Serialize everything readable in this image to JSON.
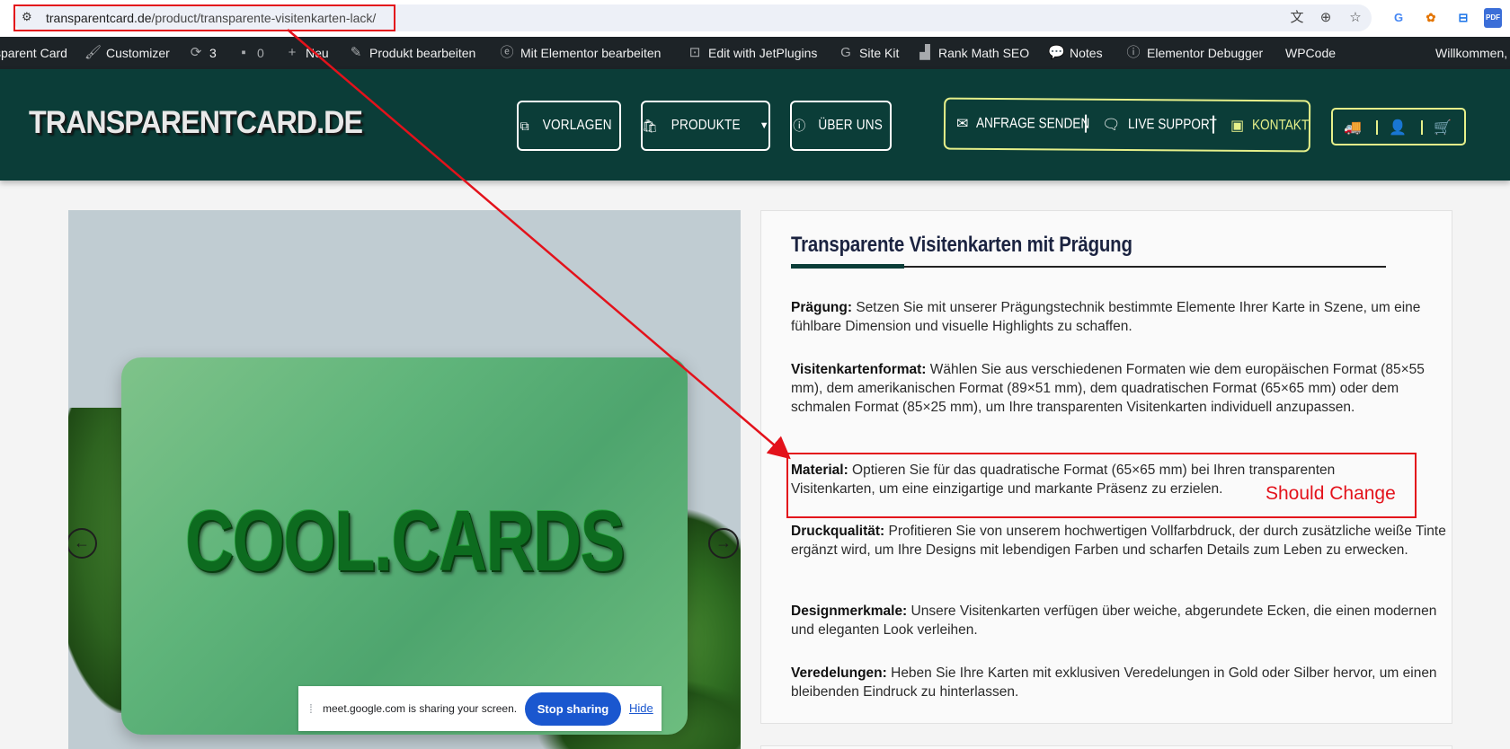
{
  "browser": {
    "url_domain": "transparentcard.de",
    "url_path": "/product/transparente-visitenkarten-lack/",
    "icons": [
      "site-info-icon",
      "translate-icon",
      "zoom-icon",
      "star-icon"
    ],
    "extensions": [
      "google-translate-ext",
      "colorful-ext",
      "screenshot-ext",
      "pdf-ext"
    ],
    "ext_labels": [
      "G",
      "✿",
      "⊟",
      "PDF"
    ]
  },
  "adminbar": {
    "site_name": "sparent Card",
    "customizer": "Customizer",
    "updates_count": "3",
    "comments_count": "0",
    "new_label": "Neu",
    "edit_product": "Produkt bearbeiten",
    "elementor_edit": "Mit Elementor bearbeiten",
    "jet_edit": "Edit with JetPlugins",
    "sitekit": "Site Kit",
    "rankmath": "Rank Math SEO",
    "notes": "Notes",
    "debugger": "Elementor Debugger",
    "wpcode": "WPCode",
    "welcome": "Willkommen,"
  },
  "header": {
    "logo": "TRANSPARENTCARD.DE",
    "nav": {
      "vorlagen": "VORLAGEN",
      "produkte": "PRODUKTE",
      "ueber_uns": "ÜBER UNS"
    },
    "cta": {
      "anfrage": "ANFRAGE SENDEN",
      "support": "LIVE SUPPORT",
      "kontakt": "KONTAKT"
    },
    "accent_color": "#e6f08a",
    "bg_color": "#0b3d38"
  },
  "gallery": {
    "card_text": "COOL.CARDS"
  },
  "screen_share": {
    "message": "meet.google.com is sharing your screen.",
    "stop_label": "Stop sharing",
    "hide_label": "Hide"
  },
  "description": {
    "title": "Transparente Visitenkarten mit Prägung",
    "items": [
      {
        "label": "Prägung:",
        "text": " Setzen Sie mit unserer Prägungstechnik bestimmte Elemente Ihrer Karte in Szene, um eine fühlbare Dimension und visuelle Highlights zu schaffen."
      },
      {
        "label": "Visitenkartenformat:",
        "text": " Wählen Sie aus verschiedenen Formaten wie dem europäischen Format (85×55 mm), dem amerikanischen Format (89×51 mm), dem quadratischen Format (65×65 mm) oder dem schmalen Format (85×25 mm), um Ihre transparenten Visitenkarten individuell anzupassen."
      },
      {
        "label": "Material:",
        "text": " Optieren Sie für das quadratische Format (65×65 mm) bei Ihren transparenten Visitenkarten, um eine einzigartige und markante Präsenz zu erzielen."
      },
      {
        "label": "Druckqualität:",
        "text": " Profitieren Sie von unserem hochwertigen Vollfarbdruck, der durch zusätzliche weiße Tinte ergänzt wird, um Ihre Designs mit lebendigen Farben und scharfen Details zum Leben zu erwecken."
      },
      {
        "label": "Designmerkmale:",
        "text": " Unsere Visitenkarten verfügen über weiche, abgerundete Ecken, die einen modernen und eleganten Look verleihen."
      },
      {
        "label": "Veredelungen:",
        "text": " Heben Sie Ihre Karten mit exklusiven Veredelungen in Gold oder Silber hervor, um einen bleibenden Eindruck zu hinterlassen."
      }
    ]
  },
  "annotation": {
    "note": "Should Change",
    "color": "#e3121b"
  }
}
